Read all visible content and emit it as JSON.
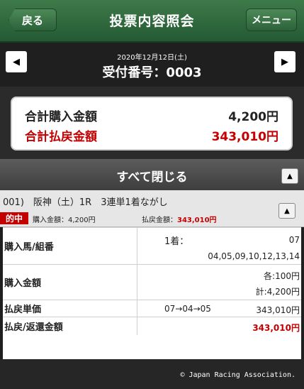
{
  "header": {
    "back_label": "戻る",
    "title": "投票内容照会",
    "menu_label": "メニュー"
  },
  "date_nav": {
    "date": "2020年12月12日(土)",
    "receipt_label": "受付番号：0003",
    "prev_icon": "◀",
    "next_icon": "▶"
  },
  "summary": {
    "purchase_label": "合計購入金額",
    "purchase_value": "4,200円",
    "payout_label": "合計払戻金額",
    "payout_value": "343,010円"
  },
  "close_all": {
    "label": "すべて閉じる",
    "icon": "▲"
  },
  "race": {
    "title": "001)　阪神（土）1R　3連単1着ながし",
    "hit_label": "的中",
    "purchase_text": "購入金額：4,200円",
    "payout_prefix": "払戻金額：",
    "payout_value": "343,010円",
    "icon": "▲"
  },
  "detail": {
    "horse_label": "購入馬/組番",
    "first_label": "1着：",
    "first_value": "07",
    "other_values": "04,05,09,10,12,13,14",
    "amount_label": "購入金額",
    "amount_each": "各:100円",
    "amount_total": "計:4,200円",
    "unit_label": "払戻単価",
    "unit_combo": "07→04→05",
    "unit_value": "343,010円",
    "payout_label": "払戻/返還金額",
    "payout_value": "343,010円"
  },
  "footer": {
    "copyright": "© Japan Racing Association."
  },
  "colors": {
    "header_green": "#2c6239",
    "accent_red": "#c40000",
    "background_dark": "#1f1f1f"
  }
}
